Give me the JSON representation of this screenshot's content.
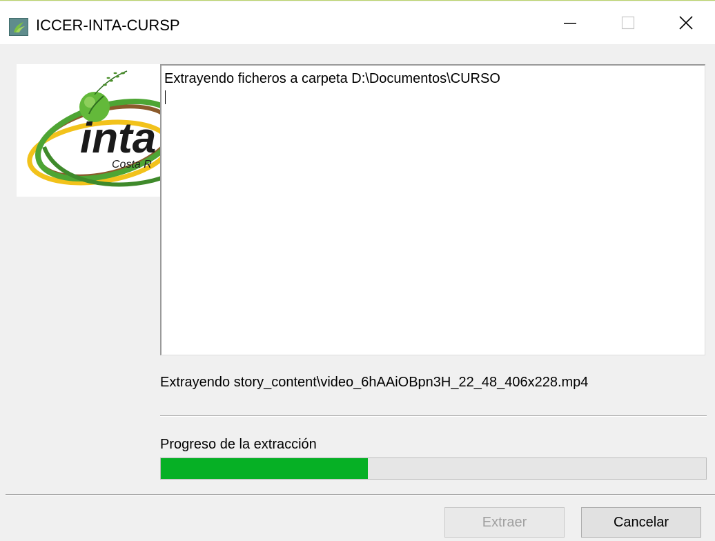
{
  "window": {
    "title": "ICCER-INTA-CURSP",
    "controls": {
      "minimize_icon": "minimize-icon",
      "maximize_icon": "maximize-icon",
      "close_icon": "close-icon"
    }
  },
  "logo": {
    "text": "inta",
    "subtext": "Costa R"
  },
  "log": {
    "lines": [
      "Extrayendo ficheros a carpeta D:\\Documentos\\CURSO"
    ]
  },
  "status": {
    "current_file": "Extrayendo story_content\\video_6hAAiOBpn3H_22_48_406x228.mp4"
  },
  "progress": {
    "label": "Progreso de la extracción",
    "fraction": 0.38,
    "color": "#06b025"
  },
  "buttons": {
    "extract_label": "Extraer",
    "cancel_label": "Cancelar"
  }
}
